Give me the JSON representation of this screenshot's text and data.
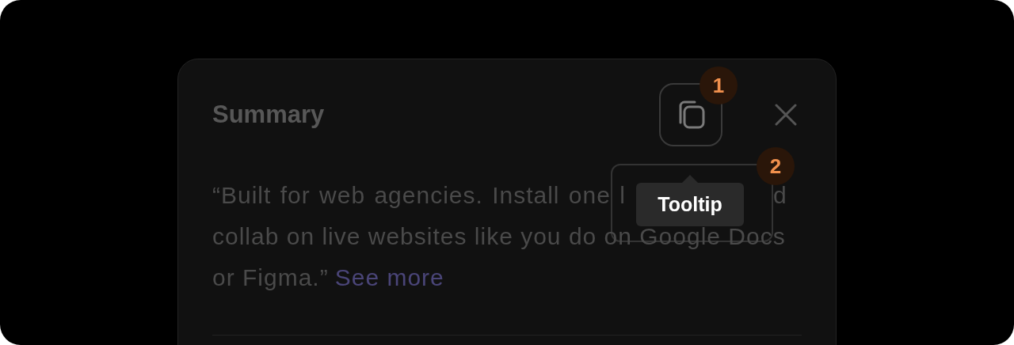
{
  "summary": {
    "title": "Summary",
    "copy_badge": "1",
    "quote_lines": [
      {
        "parts": [
          "“Built for web agencies. Install one l",
          "d"
        ]
      },
      {
        "parts": [
          "collab on live websites like you do on Google Docs"
        ]
      },
      {
        "parts": [
          "or Figma.”"
        ]
      }
    ],
    "link": "See more",
    "tooltip": {
      "text": "Tooltip",
      "badge": "2"
    }
  }
}
